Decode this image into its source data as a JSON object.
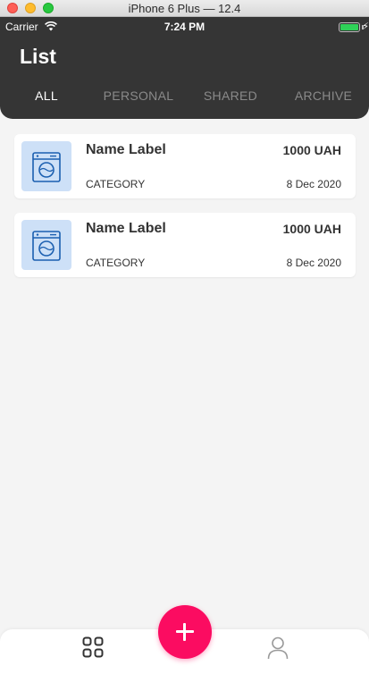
{
  "window": {
    "title": "iPhone 6 Plus — 12.4"
  },
  "status_bar": {
    "carrier": "Carrier",
    "time": "7:24 PM"
  },
  "header": {
    "title": "List"
  },
  "tabs": [
    {
      "label": "ALL",
      "active": true
    },
    {
      "label": "PERSONAL",
      "active": false
    },
    {
      "label": "SHARED",
      "active": false
    },
    {
      "label": "ARCHIVE",
      "active": false
    }
  ],
  "items": [
    {
      "name": "Name Label",
      "amount": "1000 UAH",
      "category": "CATEGORY",
      "date": "8 Dec 2020",
      "icon": "washing-machine-icon"
    },
    {
      "name": "Name Label",
      "amount": "1000 UAH",
      "category": "CATEGORY",
      "date": "8 Dec 2020",
      "icon": "washing-machine-icon"
    }
  ],
  "bottom_nav": {
    "left_icon": "grid-icon",
    "center_icon": "plus-icon",
    "right_icon": "profile-icon"
  },
  "colors": {
    "header_bg": "#353535",
    "accent": "#fb0c61",
    "thumb_bg": "#cde0f7",
    "icon_blue": "#1b5fb0",
    "battery": "#2fd158"
  }
}
